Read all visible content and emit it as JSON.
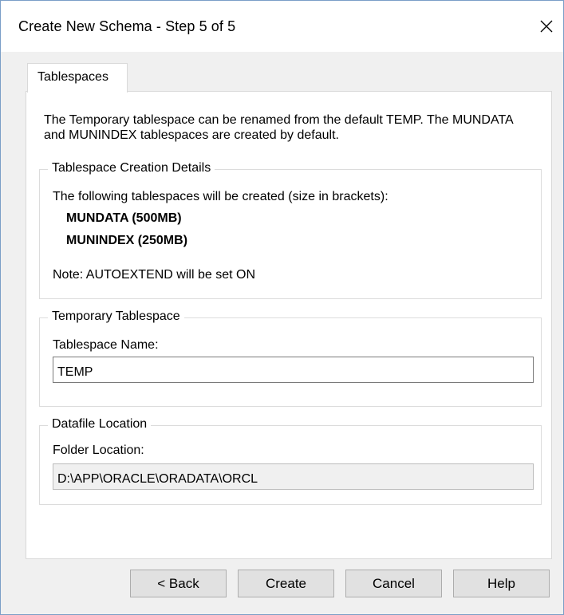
{
  "window": {
    "title": "Create New Schema - Step 5 of 5"
  },
  "icons": {
    "close": "close-icon"
  },
  "tabs": [
    {
      "label": "Tablespaces",
      "active": true
    }
  ],
  "intro_text": "The Temporary tablespace can be renamed from the default TEMP. The MUNDATA and MUNINDEX tablespaces are created by default.",
  "creation_details": {
    "legend": "Tablespace Creation Details",
    "description": "The following tablespaces will be created (size in brackets):",
    "tablespaces": [
      "MUNDATA (500MB)",
      "MUNINDEX (250MB)"
    ],
    "note": "Note: AUTOEXTEND will be set ON"
  },
  "temporary_tablespace": {
    "legend": "Temporary Tablespace",
    "field_label": "Tablespace Name:",
    "value": "TEMP"
  },
  "datafile_location": {
    "legend": "Datafile Location",
    "field_label": "Folder Location:",
    "value": "D:\\APP\\ORACLE\\ORADATA\\ORCL"
  },
  "buttons": {
    "back": "< Back",
    "create": "Create",
    "cancel": "Cancel",
    "help": "Help"
  },
  "colors": {
    "window_border": "#7a9ec7",
    "dialog_background": "#f0f0f0",
    "button_face": "#e1e1e1"
  }
}
